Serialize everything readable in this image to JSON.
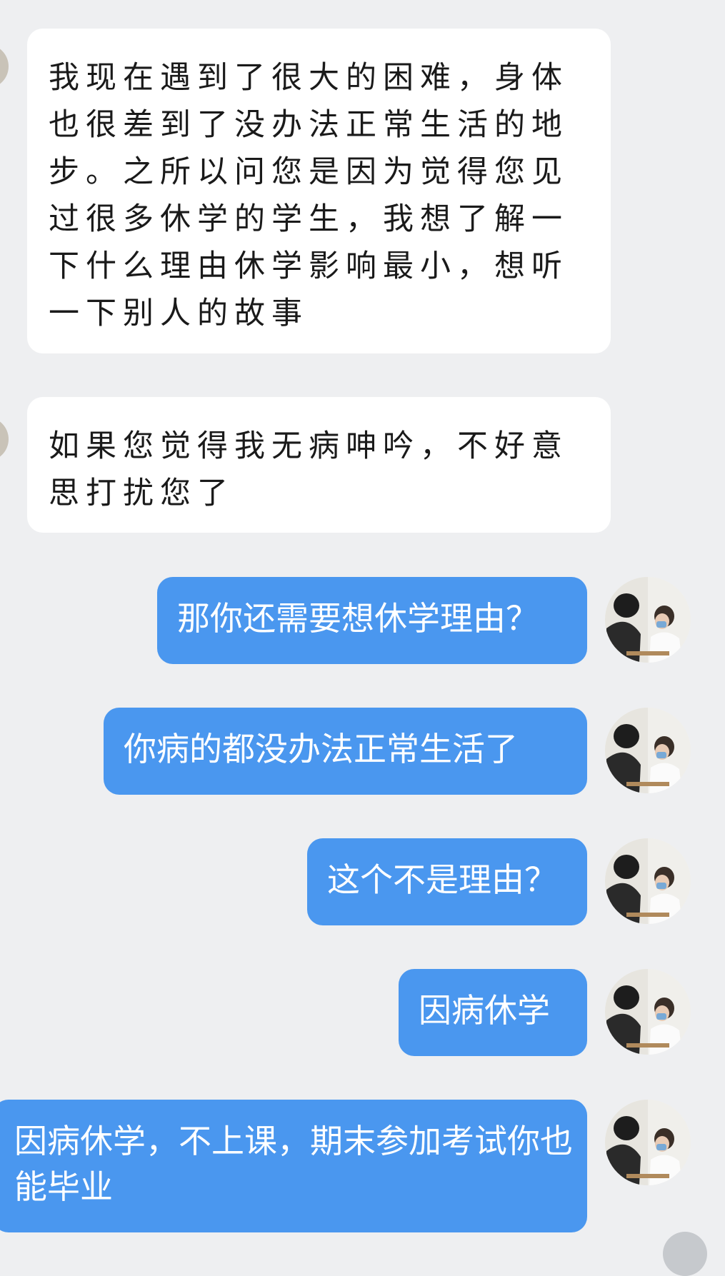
{
  "conversation": {
    "messages": [
      {
        "from": "other",
        "text": "我现在遇到了很大的困难，身体也很差到了没办法正常生活的地步。之所以问您是因为觉得您见过很多休学的学生，我想了解一下什么理由休学影响最小，想听一下别人的故事"
      },
      {
        "from": "other",
        "text": "如果您觉得我无病呻吟，不好意思打扰您了"
      },
      {
        "from": "me",
        "text": "那你还需要想休学理由？"
      },
      {
        "from": "me",
        "text": "你病的都没办法正常生活了"
      },
      {
        "from": "me",
        "text": "这个不是理由？"
      },
      {
        "from": "me",
        "text": "因病休学"
      },
      {
        "from": "me",
        "text": "因病休学，不上课，期末参加考试你也能毕业"
      }
    ]
  },
  "colors": {
    "background": "#eeeff1",
    "incoming_bubble": "#ffffff",
    "outgoing_bubble": "#4a97ef",
    "outgoing_text": "#ffffff"
  }
}
